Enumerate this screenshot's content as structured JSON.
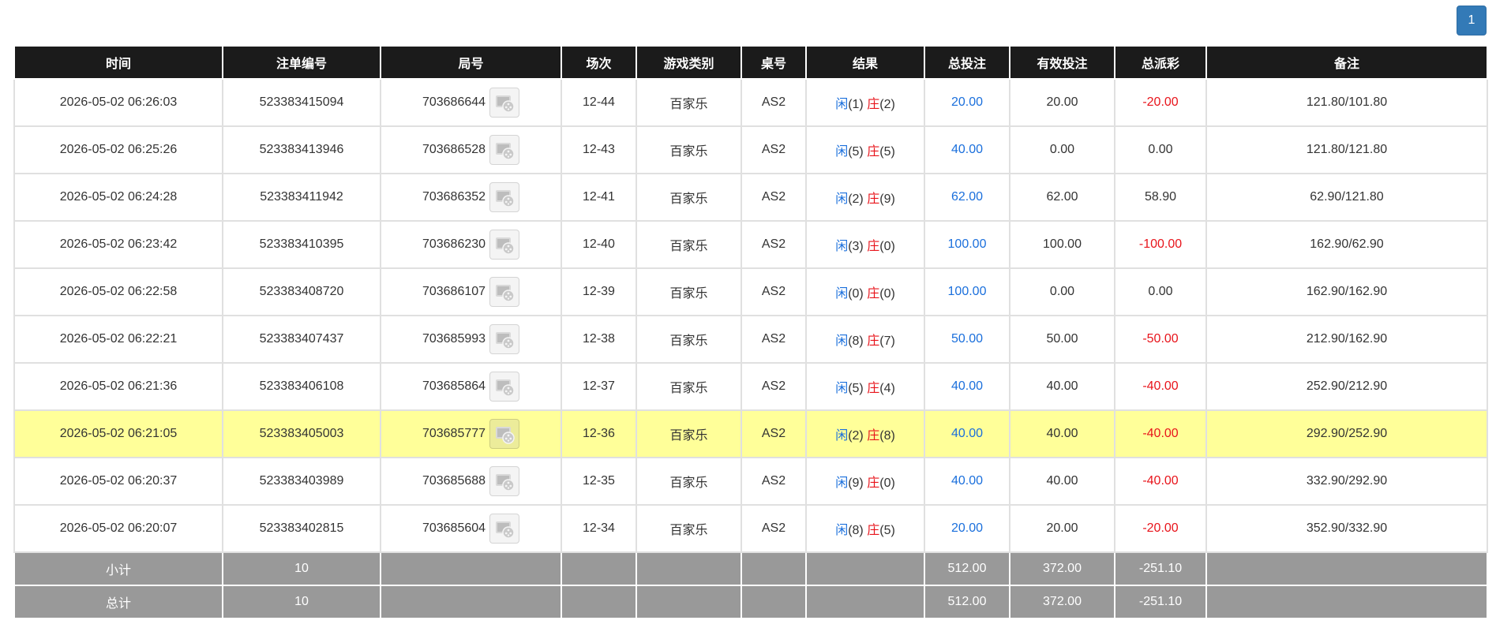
{
  "pagination": {
    "current_page": "1"
  },
  "table": {
    "headers": [
      "时间",
      "注单编号",
      "局号",
      "场次",
      "游戏类别",
      "桌号",
      "结果",
      "总投注",
      "有效投注",
      "总派彩",
      "备注"
    ],
    "player_label": "闲",
    "banker_label": "庄",
    "rows": [
      {
        "time": "2026-05-02 06:26:03",
        "bet_id": "523383415094",
        "round_id": "703686644",
        "shoe": "12-44",
        "game": "百家乐",
        "table": "AS2",
        "player_score": "(1)",
        "banker_score": "(2)",
        "total_bet": "20.00",
        "valid_bet": "20.00",
        "payout": "-20.00",
        "remark": "121.80/101.80",
        "highlight": false
      },
      {
        "time": "2026-05-02 06:25:26",
        "bet_id": "523383413946",
        "round_id": "703686528",
        "shoe": "12-43",
        "game": "百家乐",
        "table": "AS2",
        "player_score": "(5)",
        "banker_score": "(5)",
        "total_bet": "40.00",
        "valid_bet": "0.00",
        "payout": "0.00",
        "remark": "121.80/121.80",
        "highlight": false
      },
      {
        "time": "2026-05-02 06:24:28",
        "bet_id": "523383411942",
        "round_id": "703686352",
        "shoe": "12-41",
        "game": "百家乐",
        "table": "AS2",
        "player_score": "(2)",
        "banker_score": "(9)",
        "total_bet": "62.00",
        "valid_bet": "62.00",
        "payout": "58.90",
        "remark": "62.90/121.80",
        "highlight": false
      },
      {
        "time": "2026-05-02 06:23:42",
        "bet_id": "523383410395",
        "round_id": "703686230",
        "shoe": "12-40",
        "game": "百家乐",
        "table": "AS2",
        "player_score": "(3)",
        "banker_score": "(0)",
        "total_bet": "100.00",
        "valid_bet": "100.00",
        "payout": "-100.00",
        "remark": "162.90/62.90",
        "highlight": false
      },
      {
        "time": "2026-05-02 06:22:58",
        "bet_id": "523383408720",
        "round_id": "703686107",
        "shoe": "12-39",
        "game": "百家乐",
        "table": "AS2",
        "player_score": "(0)",
        "banker_score": "(0)",
        "total_bet": "100.00",
        "valid_bet": "0.00",
        "payout": "0.00",
        "remark": "162.90/162.90",
        "highlight": false
      },
      {
        "time": "2026-05-02 06:22:21",
        "bet_id": "523383407437",
        "round_id": "703685993",
        "shoe": "12-38",
        "game": "百家乐",
        "table": "AS2",
        "player_score": "(8)",
        "banker_score": "(7)",
        "total_bet": "50.00",
        "valid_bet": "50.00",
        "payout": "-50.00",
        "remark": "212.90/162.90",
        "highlight": false
      },
      {
        "time": "2026-05-02 06:21:36",
        "bet_id": "523383406108",
        "round_id": "703685864",
        "shoe": "12-37",
        "game": "百家乐",
        "table": "AS2",
        "player_score": "(5)",
        "banker_score": "(4)",
        "total_bet": "40.00",
        "valid_bet": "40.00",
        "payout": "-40.00",
        "remark": "252.90/212.90",
        "highlight": false
      },
      {
        "time": "2026-05-02 06:21:05",
        "bet_id": "523383405003",
        "round_id": "703685777",
        "shoe": "12-36",
        "game": "百家乐",
        "table": "AS2",
        "player_score": "(2)",
        "banker_score": "(8)",
        "total_bet": "40.00",
        "valid_bet": "40.00",
        "payout": "-40.00",
        "remark": "292.90/252.90",
        "highlight": true
      },
      {
        "time": "2026-05-02 06:20:37",
        "bet_id": "523383403989",
        "round_id": "703685688",
        "shoe": "12-35",
        "game": "百家乐",
        "table": "AS2",
        "player_score": "(9)",
        "banker_score": "(0)",
        "total_bet": "40.00",
        "valid_bet": "40.00",
        "payout": "-40.00",
        "remark": "332.90/292.90",
        "highlight": false
      },
      {
        "time": "2026-05-02 06:20:07",
        "bet_id": "523383402815",
        "round_id": "703685604",
        "shoe": "12-34",
        "game": "百家乐",
        "table": "AS2",
        "player_score": "(8)",
        "banker_score": "(5)",
        "total_bet": "20.00",
        "valid_bet": "20.00",
        "payout": "-20.00",
        "remark": "352.90/332.90",
        "highlight": false
      }
    ],
    "subtotal": {
      "label": "小计",
      "count": "10",
      "total_bet": "512.00",
      "valid_bet": "372.00",
      "payout": "-251.10"
    },
    "total": {
      "label": "总计",
      "count": "10",
      "total_bet": "512.00",
      "valid_bet": "372.00",
      "payout": "-251.10"
    }
  },
  "icons": {
    "round_detail": "replay-film-reel-icon"
  },
  "colors": {
    "header_bg": "#1b1b1b",
    "highlight_row": "#ffff99",
    "summary_bg": "#999999",
    "blue_text": "#1a6fdc",
    "red_text": "#e8141b",
    "pager": "#337ab7"
  }
}
